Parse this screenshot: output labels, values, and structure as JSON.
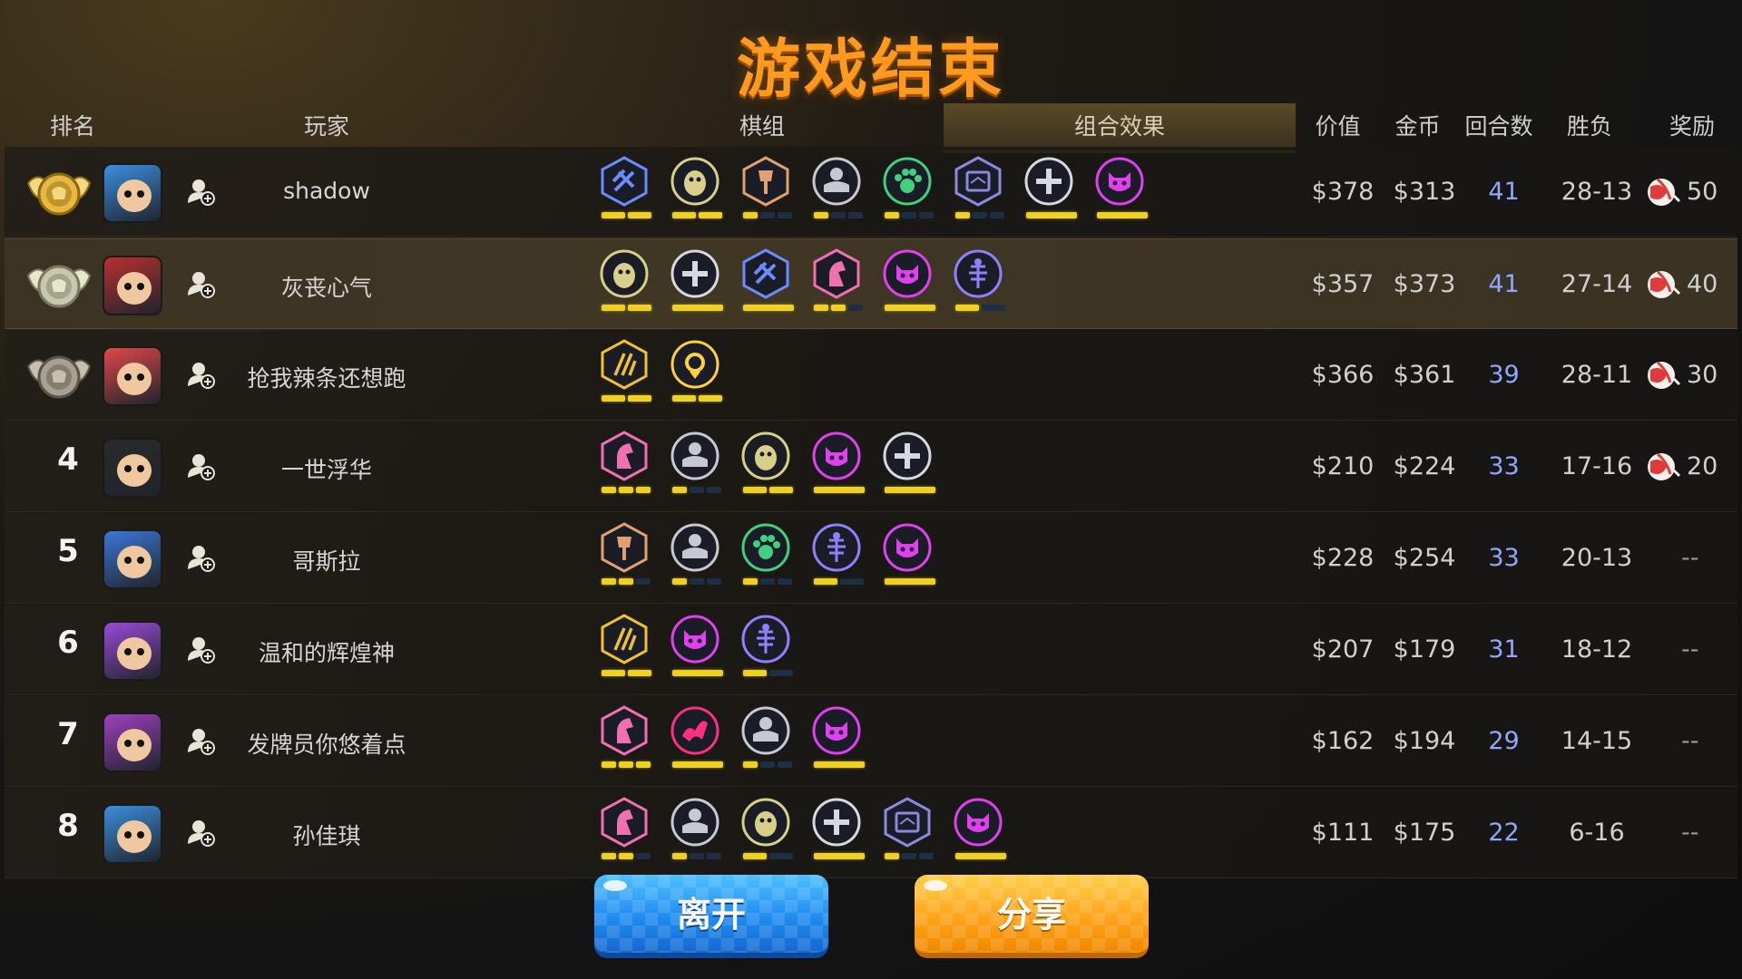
{
  "title": "游戏结束",
  "header": {
    "rank": "排名",
    "player": "玩家",
    "deck": "棋组",
    "combo": "组合效果",
    "value": "价值",
    "gold": "金币",
    "rounds": "回合数",
    "winloss": "胜负",
    "reward": "奖励"
  },
  "colors": {
    "title": "#ff9a1f",
    "bar_on": "#f0d020",
    "bar_off": "#1d2f44",
    "rounds_text": "#8fa8ff",
    "leave_button": "#1f8cf0",
    "share_button": "#ffa41a"
  },
  "synergy_types": {
    "mech": {
      "icon": "mech-knife-icon",
      "color": "#6a8cff",
      "ring": "#3a54b0"
    },
    "penguin": {
      "icon": "penguin-icon",
      "color": "#d6d08a",
      "ring": "#6a6636"
    },
    "axe": {
      "icon": "axe-icon",
      "color": "#e0a070",
      "ring": "#6e4a2e"
    },
    "sofa": {
      "icon": "sofa-icon",
      "color": "#c8c8d0",
      "ring": "#5a5a66"
    },
    "paw": {
      "icon": "paw-icon",
      "color": "#40d080",
      "ring": "#1e6a44"
    },
    "tablet": {
      "icon": "tablet-icon",
      "color": "#8a8ae0",
      "ring": "#3c3c78"
    },
    "cross": {
      "icon": "cross-icon",
      "color": "#d8d8e0",
      "ring": "#5a5a66"
    },
    "demon": {
      "icon": "demon-icon",
      "color": "#e040f0",
      "ring": "#7a1a8a"
    },
    "knight": {
      "icon": "knight-icon",
      "color": "#f070b0",
      "ring": "#7a2a5a"
    },
    "fishbone": {
      "icon": "fishbone-icon",
      "color": "#9080ff",
      "ring": "#3a2e90"
    },
    "claw": {
      "icon": "claw-icon",
      "color": "#f0c030",
      "ring": "#6a5418"
    },
    "ring": {
      "icon": "ring-icon",
      "color": "#ffd040",
      "ring": "#8a6a10"
    },
    "bat": {
      "icon": "bat-icon",
      "color": "#ff3080",
      "ring": "#7a1444"
    }
  },
  "players": [
    {
      "rank": "1",
      "medal": "gold",
      "name": "shadow",
      "avatar": "blue-knight-avatar",
      "avatar_color": "#3a90e0",
      "value": "$378",
      "gold": "$313",
      "rounds": "41",
      "winloss": "28-13",
      "reward": "50",
      "highlight": false,
      "synergies": [
        {
          "t": "mech",
          "on": 2,
          "total": 2
        },
        {
          "t": "penguin",
          "on": 2,
          "total": 2
        },
        {
          "t": "axe",
          "on": 1,
          "total": 3
        },
        {
          "t": "sofa",
          "on": 1,
          "total": 3
        },
        {
          "t": "paw",
          "on": 1,
          "total": 3
        },
        {
          "t": "tablet",
          "on": 1,
          "total": 3
        },
        {
          "t": "cross",
          "on": 1,
          "total": 1
        },
        {
          "t": "demon",
          "on": 1,
          "total": 1
        }
      ]
    },
    {
      "rank": "2",
      "medal": "silver",
      "name": "灰丧心气",
      "avatar": "red-robot-avatar",
      "avatar_color": "#b83030",
      "value": "$357",
      "gold": "$373",
      "rounds": "41",
      "winloss": "27-14",
      "reward": "40",
      "highlight": true,
      "synergies": [
        {
          "t": "penguin",
          "on": 2,
          "total": 2
        },
        {
          "t": "cross",
          "on": 1,
          "total": 1
        },
        {
          "t": "mech",
          "on": 1,
          "total": 1
        },
        {
          "t": "knight",
          "on": 2,
          "total": 3
        },
        {
          "t": "demon",
          "on": 1,
          "total": 1
        },
        {
          "t": "fishbone",
          "on": 1,
          "total": 2
        }
      ]
    },
    {
      "rank": "3",
      "medal": "bronze",
      "name": "抢我辣条还想跑",
      "avatar": "pink-ogre-avatar",
      "avatar_color": "#e04848",
      "value": "$366",
      "gold": "$361",
      "rounds": "39",
      "winloss": "28-11",
      "reward": "30",
      "highlight": false,
      "synergies": [
        {
          "t": "claw",
          "on": 2,
          "total": 2
        },
        {
          "t": "ring",
          "on": 2,
          "total": 2
        }
      ]
    },
    {
      "rank": "4",
      "medal": "",
      "name": "一世浮华",
      "avatar": "ninja-avatar",
      "avatar_color": "#2a2a2a",
      "value": "$210",
      "gold": "$224",
      "rounds": "33",
      "winloss": "17-16",
      "reward": "20",
      "highlight": false,
      "synergies": [
        {
          "t": "knight",
          "on": 3,
          "total": 3
        },
        {
          "t": "sofa",
          "on": 1,
          "total": 3
        },
        {
          "t": "penguin",
          "on": 2,
          "total": 2
        },
        {
          "t": "demon",
          "on": 1,
          "total": 1
        },
        {
          "t": "cross",
          "on": 1,
          "total": 1
        }
      ]
    },
    {
      "rank": "5",
      "medal": "",
      "name": "哥斯拉",
      "avatar": "blue-bird-avatar",
      "avatar_color": "#3a78d8",
      "value": "$228",
      "gold": "$254",
      "rounds": "33",
      "winloss": "20-13",
      "reward": "--",
      "highlight": false,
      "synergies": [
        {
          "t": "axe",
          "on": 2,
          "total": 3
        },
        {
          "t": "sofa",
          "on": 1,
          "total": 3
        },
        {
          "t": "paw",
          "on": 1,
          "total": 3
        },
        {
          "t": "fishbone",
          "on": 1,
          "total": 2
        },
        {
          "t": "demon",
          "on": 1,
          "total": 1
        }
      ]
    },
    {
      "rank": "6",
      "medal": "",
      "name": "温和的辉煌神",
      "avatar": "purple-witch-avatar",
      "avatar_color": "#9a4ad8",
      "value": "$207",
      "gold": "$179",
      "rounds": "31",
      "winloss": "18-12",
      "reward": "--",
      "highlight": false,
      "synergies": [
        {
          "t": "claw",
          "on": 2,
          "total": 2
        },
        {
          "t": "demon",
          "on": 1,
          "total": 1
        },
        {
          "t": "fishbone",
          "on": 1,
          "total": 2
        }
      ]
    },
    {
      "rank": "7",
      "medal": "",
      "name": "发牌员你悠着点",
      "avatar": "pirate-girl-avatar",
      "avatar_color": "#a040c0",
      "value": "$162",
      "gold": "$194",
      "rounds": "29",
      "winloss": "14-15",
      "reward": "--",
      "highlight": false,
      "synergies": [
        {
          "t": "knight",
          "on": 3,
          "total": 3
        },
        {
          "t": "bat",
          "on": 1,
          "total": 1
        },
        {
          "t": "sofa",
          "on": 1,
          "total": 3
        },
        {
          "t": "demon",
          "on": 1,
          "total": 1
        }
      ]
    },
    {
      "rank": "8",
      "medal": "",
      "name": "孙佳琪",
      "avatar": "blue-knight-avatar",
      "avatar_color": "#3a90e0",
      "value": "$111",
      "gold": "$175",
      "rounds": "22",
      "winloss": "6-16",
      "reward": "--",
      "highlight": false,
      "synergies": [
        {
          "t": "knight",
          "on": 2,
          "total": 3
        },
        {
          "t": "sofa",
          "on": 1,
          "total": 3
        },
        {
          "t": "penguin",
          "on": 1,
          "total": 2
        },
        {
          "t": "cross",
          "on": 1,
          "total": 1
        },
        {
          "t": "tablet",
          "on": 1,
          "total": 3
        },
        {
          "t": "demon",
          "on": 1,
          "total": 1
        }
      ]
    }
  ],
  "buttons": {
    "leave": "离开",
    "share": "分享"
  }
}
